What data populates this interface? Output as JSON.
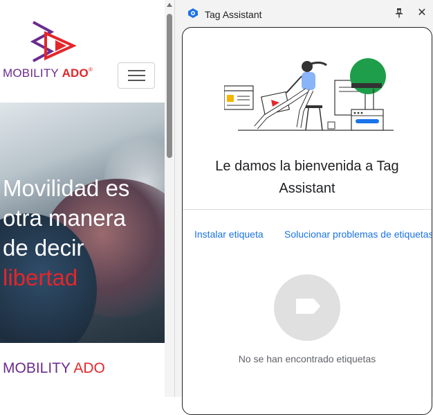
{
  "website": {
    "brand_main": "MOBILITY ",
    "brand_accent": "ADO",
    "brand_reg": "®",
    "hero_line1": "Movilidad es",
    "hero_line2": "otra manera",
    "hero_line3": "de decir",
    "hero_line4": "libertad",
    "footer_brand_main": "MOBILITY ",
    "footer_brand_accent": "ADO"
  },
  "tag_assistant": {
    "title": "Tag Assistant",
    "pin_icon": "pin-icon",
    "close_icon": "close-icon",
    "welcome_line1": "Le damos la bienvenida a Tag",
    "welcome_line2": "Assistant",
    "tabs": [
      {
        "label": "Instalar etiqueta"
      },
      {
        "label": "Solucionar problemas de etiquetas"
      }
    ],
    "empty_state": "No se han encontrado etiquetas"
  },
  "colors": {
    "brand_purple": "#6a2c8e",
    "brand_red": "#e4262a",
    "link_blue": "#1a73e8",
    "illustration_green": "#1e9e4a"
  }
}
